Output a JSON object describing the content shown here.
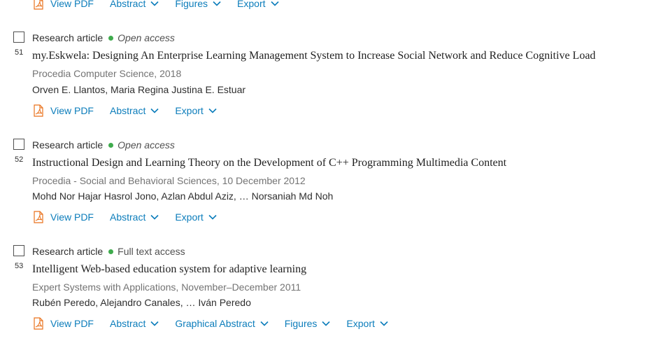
{
  "top_actions": {
    "view_pdf": "View PDF",
    "abstract": "Abstract",
    "figures": "Figures",
    "export": "Export"
  },
  "colors": {
    "link": "#0c7dbb",
    "open_access_dot": "#3fab4d",
    "pdf_red": "#e9711c"
  },
  "icons": [
    "pdf-icon",
    "chevron-down-icon"
  ],
  "results": [
    {
      "number": "51",
      "type": "Research article",
      "access": "Open access",
      "title": "my.Eskwela: Designing An Enterprise Learning Management System to Increase Social Network and Reduce Cognitive Load",
      "source": "Procedia Computer Science, 2018",
      "authors": "Orven E. Llantos, Maria Regina Justina E. Estuar",
      "actions": [
        "View PDF",
        "Abstract",
        "Export"
      ]
    },
    {
      "number": "52",
      "type": "Research article",
      "access": "Open access",
      "title": "Instructional Design and Learning Theory on the Development of C++ Programming Multimedia Content",
      "source": "Procedia - Social and Behavioral Sciences, 10 December 2012",
      "authors": "Mohd Nor Hajar Hasrol Jono, Azlan Abdul Aziz, … Norsaniah Md Noh",
      "actions": [
        "View PDF",
        "Abstract",
        "Export"
      ]
    },
    {
      "number": "53",
      "type": "Research article",
      "access": "Full text access",
      "title": "Intelligent Web-based education system for adaptive learning",
      "source": "Expert Systems with Applications, November–December 2011",
      "authors": "Rubén Peredo, Alejandro Canales, … Iván Peredo",
      "actions": [
        "View PDF",
        "Abstract",
        "Graphical Abstract",
        "Figures",
        "Export"
      ]
    }
  ]
}
